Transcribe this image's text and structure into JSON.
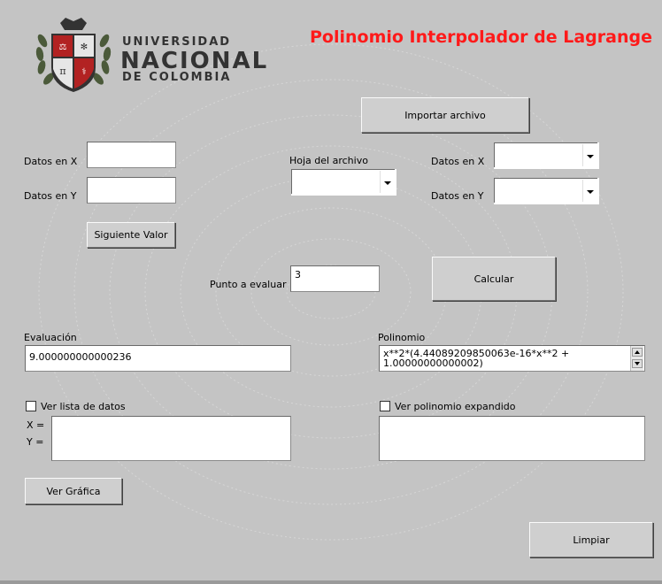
{
  "app": {
    "title": "Polinomio Interpolador de Lagrange",
    "title_color": "#ff1a1a",
    "background_color": "#c4c4c4"
  },
  "logo": {
    "icon": "university-shield-icon",
    "line1": "UNIVERSIDAD",
    "line2": "NACIONAL",
    "line3": "DE COLOMBIA"
  },
  "manual_entry": {
    "x_label": "Datos en X",
    "x_value": "",
    "y_label": "Datos en Y",
    "y_value": "",
    "next_button": "Siguiente Valor"
  },
  "file_import": {
    "import_button": "Importar archivo",
    "sheet_label": "Hoja del archivo",
    "sheet_value": "",
    "x_label": "Datos en X",
    "x_value": "",
    "y_label": "Datos en Y",
    "y_value": ""
  },
  "evaluation": {
    "point_label": "Punto a evaluar",
    "point_value": "3",
    "calculate_button": "Calcular",
    "result_label": "Evaluación",
    "result_value": "9.000000000000236",
    "polynomial_label": "Polinomio",
    "polynomial_line1": "x**2*(4.44089209850063e-16*x**2 +",
    "polynomial_line2": "1.00000000000002)"
  },
  "data_list": {
    "checkbox_label": "Ver lista de datos",
    "checked": false,
    "x_prefix": "X =",
    "y_prefix": "Y ="
  },
  "expanded": {
    "checkbox_label": "Ver polinomio expandido",
    "checked": false,
    "value": ""
  },
  "actions": {
    "graph_button": "Ver Gráfica",
    "clear_button": "Limpiar"
  }
}
